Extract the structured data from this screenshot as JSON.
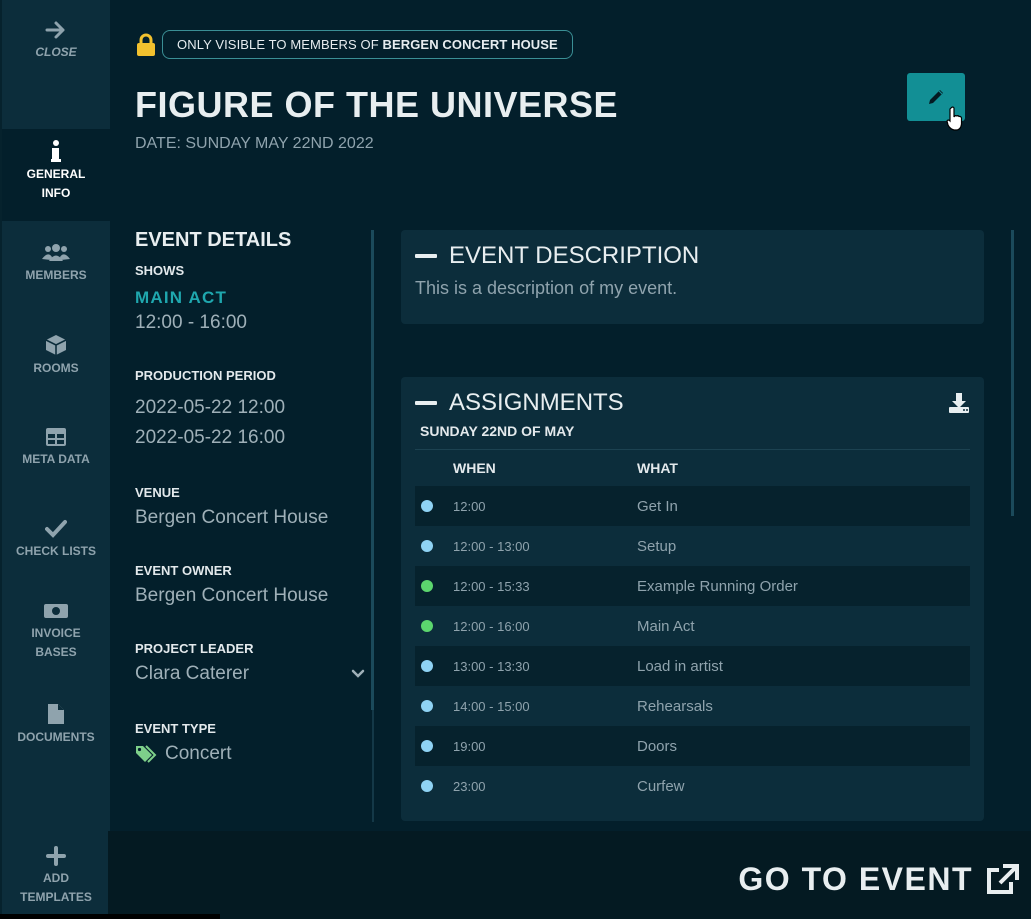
{
  "sidebar": {
    "close": "CLOSE",
    "items": [
      {
        "label1": "GENERAL",
        "label2": "INFO"
      },
      {
        "label1": "MEMBERS",
        "label2": ""
      },
      {
        "label1": "ROOMS",
        "label2": ""
      },
      {
        "label1": "META DATA",
        "label2": ""
      },
      {
        "label1": "CHECK LISTS",
        "label2": ""
      },
      {
        "label1": "INVOICE",
        "label2": "BASES"
      },
      {
        "label1": "DOCUMENTS",
        "label2": ""
      },
      {
        "label1": "ADD",
        "label2": "TEMPLATES"
      }
    ]
  },
  "header": {
    "privacy_prefix": "ONLY VISIBLE TO MEMBERS OF ",
    "privacy_org": "BERGEN CONCERT HOUSE",
    "title": "FIGURE OF THE UNIVERSE",
    "date": "DATE: SUNDAY MAY 22ND 2022"
  },
  "details": {
    "heading": "EVENT DETAILS",
    "shows_label": "SHOWS",
    "show_name": "MAIN ACT",
    "show_time": "12:00 - 16:00",
    "production_label": "PRODUCTION PERIOD",
    "production_start": "2022-05-22 12:00",
    "production_end": "2022-05-22 16:00",
    "venue_label": "VENUE",
    "venue": "Bergen Concert House",
    "owner_label": "EVENT OWNER",
    "owner": "Bergen Concert House",
    "leader_label": "PROJECT LEADER",
    "leader": "Clara Caterer",
    "type_label": "EVENT TYPE",
    "type": "Concert"
  },
  "description": {
    "title": "EVENT DESCRIPTION",
    "text": "This is a description of my event."
  },
  "assignments": {
    "title": "ASSIGNMENTS",
    "day": "SUNDAY 22ND OF MAY",
    "col_when": "WHEN",
    "col_what": "WHAT",
    "rows": [
      {
        "when": "12:00",
        "what": "Get In",
        "color": "#8fd3f4"
      },
      {
        "when": "12:00 - 13:00",
        "what": "Setup",
        "color": "#8fd3f4"
      },
      {
        "when": "12:00 - 15:33",
        "what": "Example Running Order",
        "color": "#5cd66e"
      },
      {
        "when": "12:00 - 16:00",
        "what": "Main Act",
        "color": "#5cd66e"
      },
      {
        "when": "13:00 - 13:30",
        "what": "Load in artist",
        "color": "#8fd3f4"
      },
      {
        "when": "14:00 - 15:00",
        "what": "Rehearsals",
        "color": "#8fd3f4"
      },
      {
        "when": "19:00",
        "what": "Doors",
        "color": "#8fd3f4"
      },
      {
        "when": "23:00",
        "what": "Curfew",
        "color": "#8fd3f4"
      }
    ]
  },
  "footer": {
    "goto": "GO TO EVENT"
  },
  "colors": {
    "accent": "#128f95",
    "background": "#031f2b",
    "panel": "#0c2d3b"
  }
}
